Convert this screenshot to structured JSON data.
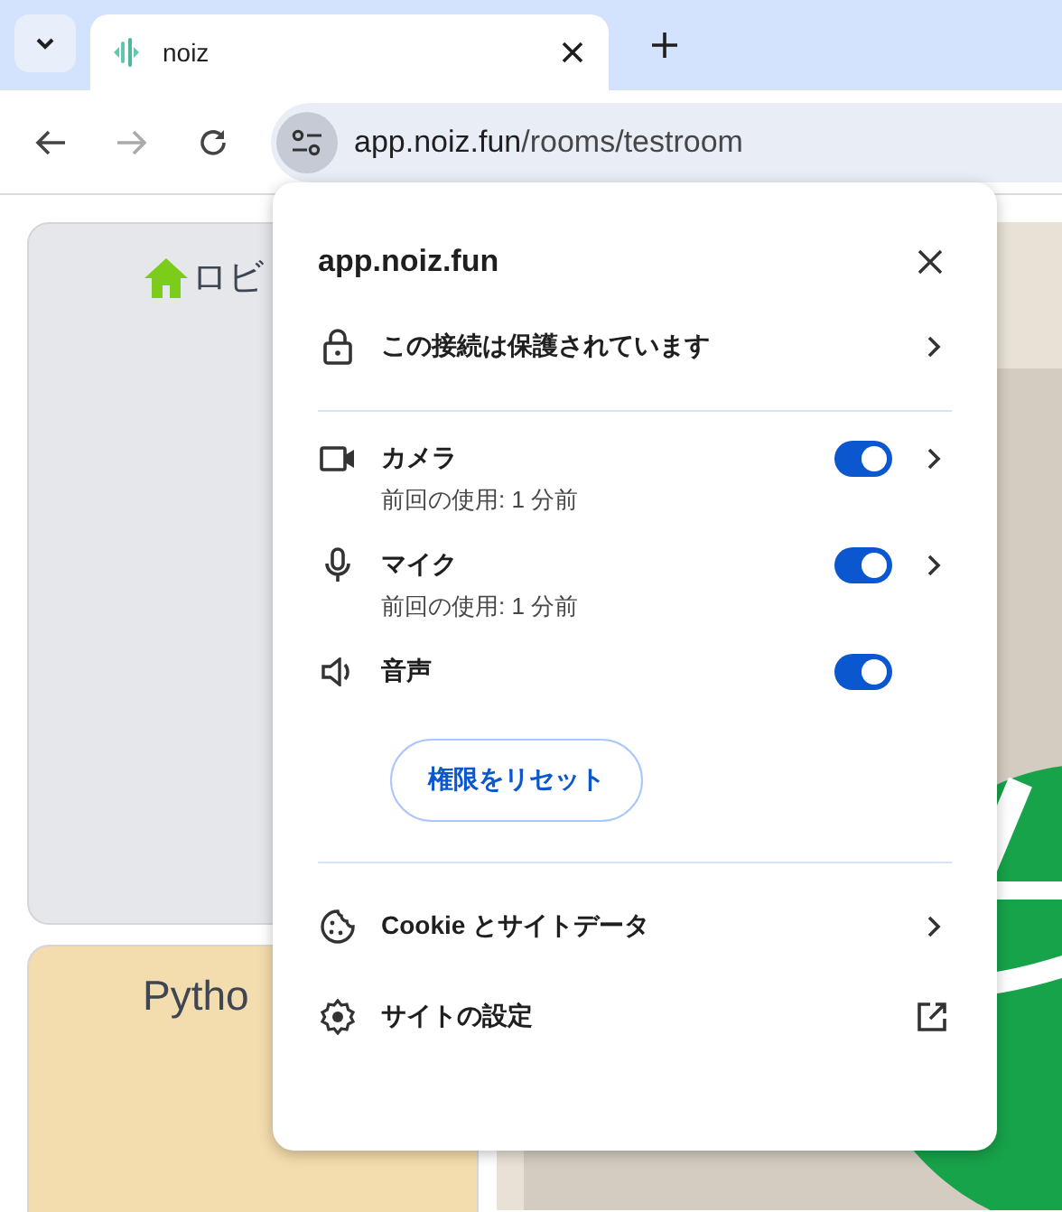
{
  "tabs": [
    {
      "title": "noiz",
      "selected": true
    }
  ],
  "address": {
    "host": "app.noiz.fun",
    "path": "/rooms/testroom"
  },
  "page": {
    "cards": [
      {
        "title": "ロビ",
        "kind": "lobby",
        "color": "#e5e7eb"
      },
      {
        "title": "Pytho",
        "kind": "plain",
        "color": "#f3dcae"
      }
    ]
  },
  "popup": {
    "title": "app.noiz.fun",
    "connection": "この接続は保護されています",
    "permissions": [
      {
        "kind": "camera",
        "name": "カメラ",
        "detail": "前回の使用: 1 分前",
        "on": true,
        "expandable": true
      },
      {
        "kind": "mic",
        "name": "マイク",
        "detail": "前回の使用: 1 分前",
        "on": true,
        "expandable": true
      },
      {
        "kind": "sound",
        "name": "音声",
        "on": true,
        "expandable": false
      }
    ],
    "reset_button": "権限をリセット",
    "links": [
      {
        "kind": "cookie",
        "label": "Cookie とサイトデータ"
      },
      {
        "kind": "settings",
        "label": "サイトの設定"
      }
    ]
  }
}
